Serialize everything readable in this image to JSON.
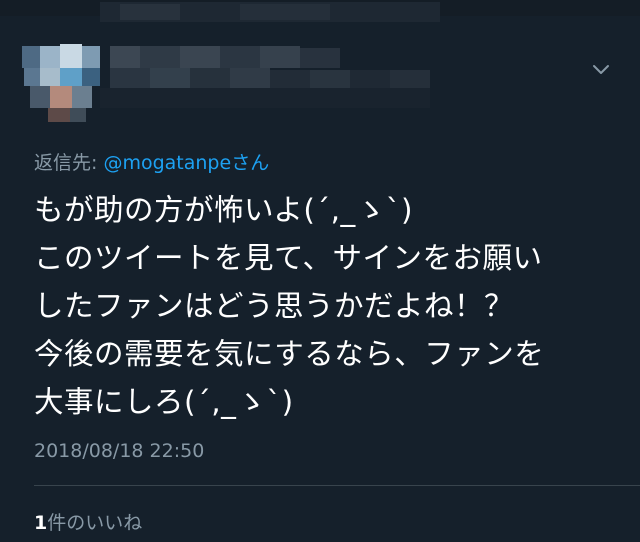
{
  "reply": {
    "prefix": "返信先: ",
    "handle": "@mogatanpe",
    "suffix": "さん"
  },
  "tweet": {
    "lines": [
      "もが助の方が怖いよ(´,_ゝ`)",
      "このツイートを見て、サインをお願い",
      "したファンはどう思うかだよね！？",
      "今後の需要を気にするなら、ファンを",
      "大事にしろ(´,_ゝ`)"
    ],
    "timestamp": "2018/08/18 22:50"
  },
  "likes": {
    "count": "1",
    "label": "件のいいね"
  },
  "icons": {
    "menu": "chevron-down-icon",
    "profile": "pixelated-avatar"
  },
  "colors": {
    "background": "#15202b",
    "secondary_text": "#8899a6",
    "link": "#1da1f2",
    "divider": "#38444d"
  }
}
